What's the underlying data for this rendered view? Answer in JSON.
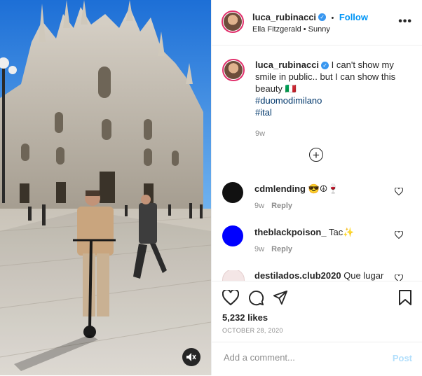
{
  "header": {
    "username": "luca_rubinacci",
    "follow_label": "Follow",
    "bullet": "•",
    "subtitle": "Ella Fitzgerald • Sunny",
    "more": "•••"
  },
  "caption": {
    "username": "luca_rubinacci",
    "text": "I can't show my smile in public.. but I can show this beauty 🇮🇹",
    "hashtags": [
      "#duomodimilano",
      "#ital"
    ],
    "time": "9w"
  },
  "comments": [
    {
      "username": "cdmlending",
      "text": "😎☮🍷",
      "time": "9w",
      "reply": "Reply",
      "avatar_color": "#111111"
    },
    {
      "username": "theblackpoison_",
      "text": "Tac✨",
      "time": "9w",
      "reply": "Reply",
      "avatar_color": "#0000ff"
    },
    {
      "username": "destilados.club2020",
      "text": "Que lugar",
      "time": "",
      "reply": "",
      "avatar_color": "#f4e6e6"
    }
  ],
  "actions": {
    "likes": "5,232 likes",
    "date": "OCTOBER 28, 2020"
  },
  "add_comment": {
    "placeholder": "Add a comment...",
    "post_label": "Post"
  },
  "colors": {
    "accent": "#0095f6",
    "sky": "#2e7fd8",
    "pavement": "#d8d3ca"
  }
}
